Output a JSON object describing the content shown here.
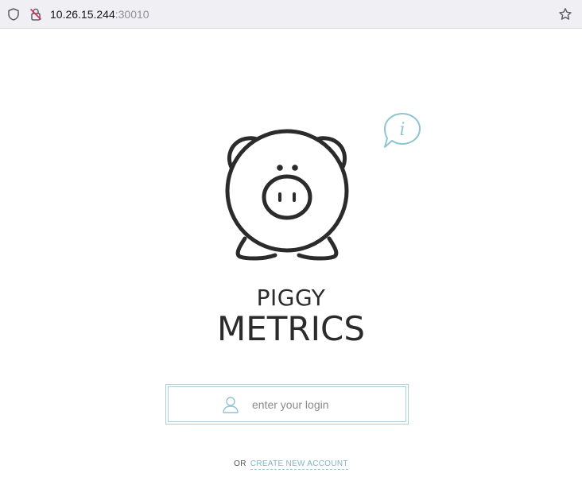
{
  "browser": {
    "url_host": "10.26.15.244",
    "url_port": ":30010"
  },
  "brand": {
    "line1": "PIGGY",
    "line2": "METRICS"
  },
  "login": {
    "placeholder": "enter your login"
  },
  "footer": {
    "or_label": "OR",
    "create_account_label": "CREATE NEW ACCOUNT"
  },
  "icons": {
    "tracking_protection": "shield-icon",
    "insecure": "lock-crossed-icon",
    "bookmark": "star-icon",
    "info": "info-bubble-icon",
    "user": "user-icon",
    "logo": "piggy-logo"
  },
  "colors": {
    "accent": "#7fb6c4",
    "text_dark": "#2b2b2b",
    "insecure_red": "#e22850"
  }
}
